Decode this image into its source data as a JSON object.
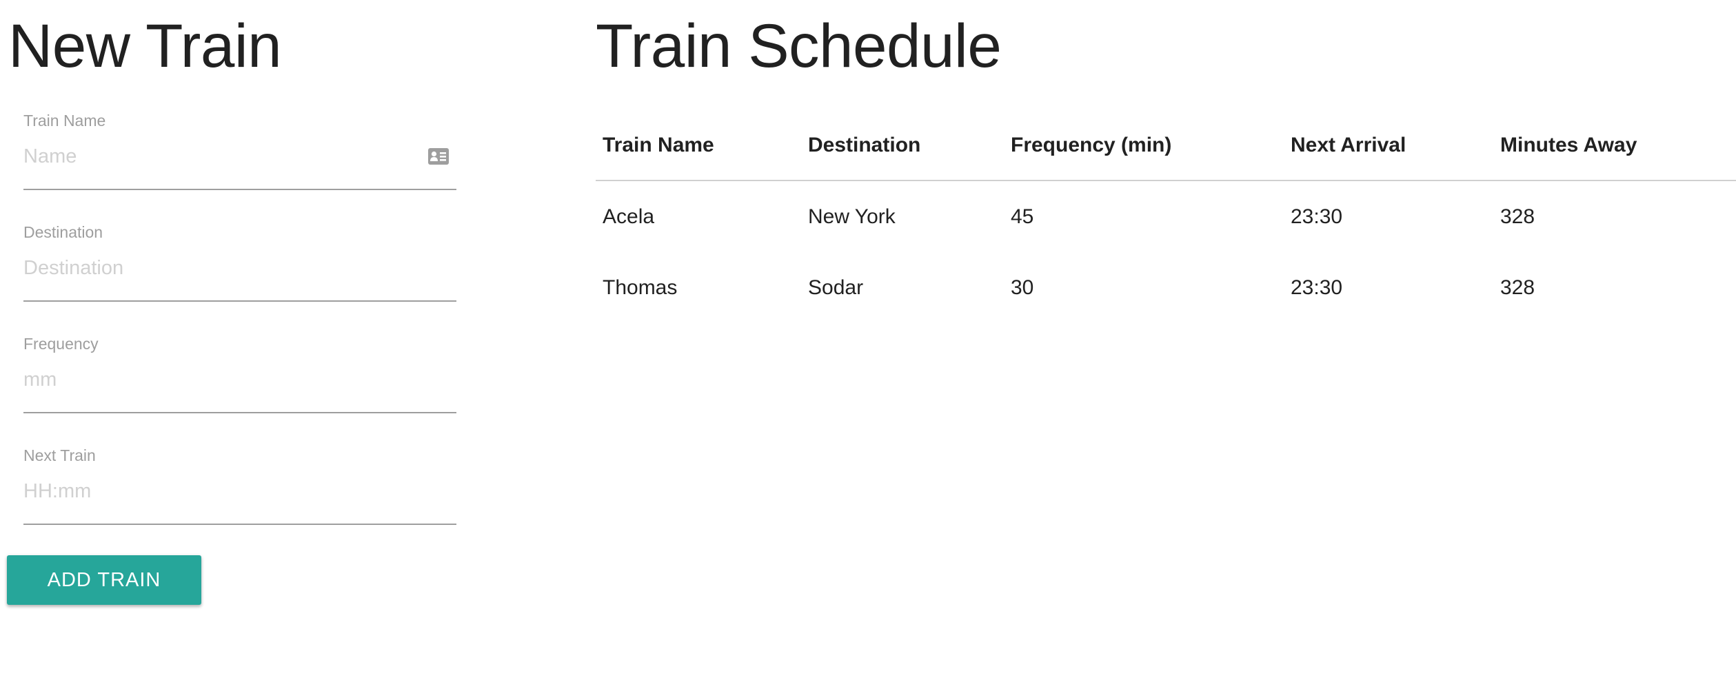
{
  "form": {
    "title": "New Train",
    "fields": [
      {
        "label": "Train Name",
        "placeholder": "Name",
        "icon": "contact-card-icon"
      },
      {
        "label": "Destination",
        "placeholder": "Destination"
      },
      {
        "label": "Frequency",
        "placeholder": "mm"
      },
      {
        "label": "Next Train",
        "placeholder": "HH:mm"
      }
    ],
    "submit_label": "ADD TRAIN",
    "accent_color": "#26a69a"
  },
  "schedule": {
    "title": "Train Schedule",
    "columns": [
      "Train Name",
      "Destination",
      "Frequency (min)",
      "Next Arrival",
      "Minutes Away"
    ],
    "rows": [
      [
        "Acela",
        "New York",
        "45",
        "23:30",
        "328"
      ],
      [
        "Thomas",
        "Sodar",
        "30",
        "23:30",
        "328"
      ]
    ]
  }
}
